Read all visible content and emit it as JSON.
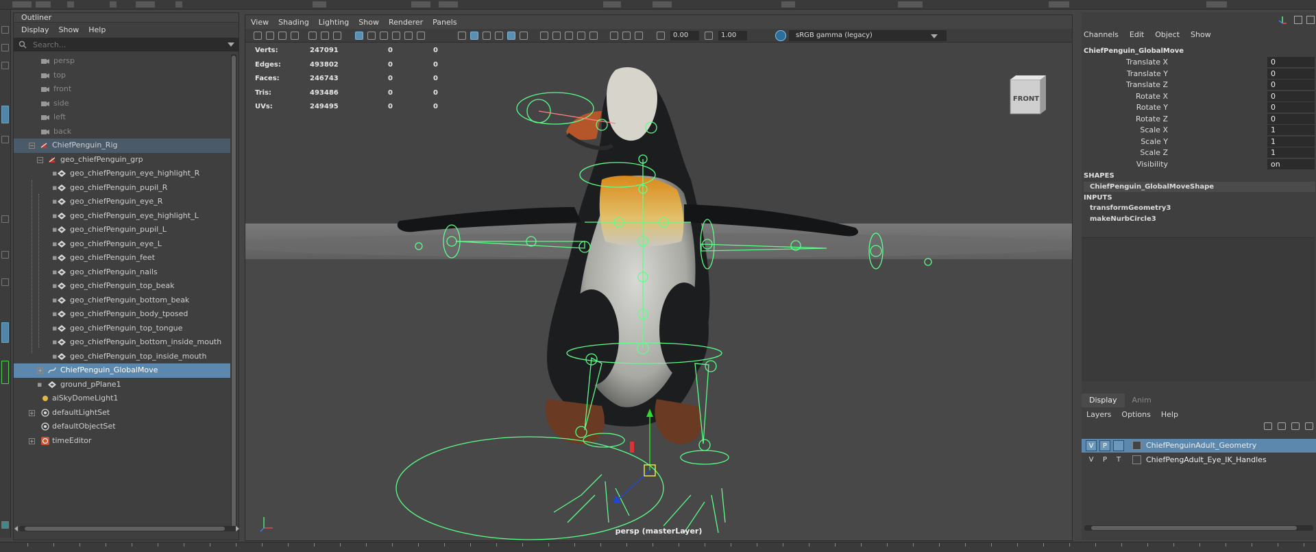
{
  "outliner": {
    "title": "Outliner",
    "menu": [
      "Display",
      "Show",
      "Help"
    ],
    "search_placeholder": "Search...",
    "items": [
      {
        "label": "persp"
      },
      {
        "label": "top"
      },
      {
        "label": "front"
      },
      {
        "label": "side"
      },
      {
        "label": "left"
      },
      {
        "label": "back"
      },
      {
        "label": "ChiefPenguin_Rig"
      },
      {
        "label": "geo_chiefPenguin_grp"
      },
      {
        "label": "geo_chiefPenguin_eye_highlight_R"
      },
      {
        "label": "geo_chiefPenguin_pupil_R"
      },
      {
        "label": "geo_chiefPenguin_eye_R"
      },
      {
        "label": "geo_chiefPenguin_eye_highlight_L"
      },
      {
        "label": "geo_chiefPenguin_pupil_L"
      },
      {
        "label": "geo_chiefPenguin_eye_L"
      },
      {
        "label": "geo_chiefPenguin_feet"
      },
      {
        "label": "geo_chiefPenguin_nails"
      },
      {
        "label": "geo_chiefPenguin_top_beak"
      },
      {
        "label": "geo_chiefPenguin_bottom_beak"
      },
      {
        "label": "geo_chiefPenguin_body_tposed"
      },
      {
        "label": "geo_chiefPenguin_top_tongue"
      },
      {
        "label": "geo_chiefPenguin_bottom_inside_mouth"
      },
      {
        "label": "geo_chiefPenguin_top_inside_mouth"
      },
      {
        "label": "ChiefPenguin_GlobalMove"
      },
      {
        "label": "ground_pPlane1"
      },
      {
        "label": "aiSkyDomeLight1"
      },
      {
        "label": "defaultLightSet"
      },
      {
        "label": "defaultObjectSet"
      },
      {
        "label": "timeEditor"
      }
    ]
  },
  "viewport": {
    "menu": [
      "View",
      "Shading",
      "Lighting",
      "Show",
      "Renderer",
      "Panels"
    ],
    "exposure": "0.00",
    "gamma": "1.00",
    "color_space": "sRGB gamma (legacy)",
    "hud": [
      {
        "label": "Verts:",
        "value": "247091",
        "sel": "0",
        "comp": "0"
      },
      {
        "label": "Edges:",
        "value": "493802",
        "sel": "0",
        "comp": "0"
      },
      {
        "label": "Faces:",
        "value": "246743",
        "sel": "0",
        "comp": "0"
      },
      {
        "label": "Tris:",
        "value": "493486",
        "sel": "0",
        "comp": "0"
      },
      {
        "label": "UVs:",
        "value": "249495",
        "sel": "0",
        "comp": "0"
      }
    ],
    "viewcube_label": "FRONT",
    "camera_label": "persp (masterLayer)"
  },
  "channel_box": {
    "menu": [
      "Channels",
      "Edit",
      "Object",
      "Show"
    ],
    "object_name": "ChiefPenguin_GlobalMove",
    "attributes": [
      {
        "name": "Translate X",
        "value": "0"
      },
      {
        "name": "Translate Y",
        "value": "0"
      },
      {
        "name": "Translate Z",
        "value": "0"
      },
      {
        "name": "Rotate X",
        "value": "0"
      },
      {
        "name": "Rotate Y",
        "value": "0"
      },
      {
        "name": "Rotate Z",
        "value": "0"
      },
      {
        "name": "Scale X",
        "value": "1"
      },
      {
        "name": "Scale Y",
        "value": "1"
      },
      {
        "name": "Scale Z",
        "value": "1"
      },
      {
        "name": "Visibility",
        "value": "on"
      }
    ],
    "shapes_header": "SHAPES",
    "shapes": [
      "ChiefPenguin_GlobalMoveShape"
    ],
    "inputs_header": "INPUTS",
    "inputs": [
      "transformGeometry3",
      "makeNurbCircle3"
    ]
  },
  "layer_editor": {
    "tabs": [
      "Display",
      "Anim"
    ],
    "menu": [
      "Layers",
      "Options",
      "Help"
    ],
    "layers": [
      {
        "v": "V",
        "p": "P",
        "t": "",
        "name": "ChiefPenguinAdult_Geometry"
      },
      {
        "v": "V",
        "p": "P",
        "t": "T",
        "name": "ChiefPengAdult_Eye_IK_Handles"
      }
    ]
  },
  "colors": {
    "selection": "#5d88ad",
    "rig_green": "#5cff8a",
    "ui_background": "#444444"
  }
}
